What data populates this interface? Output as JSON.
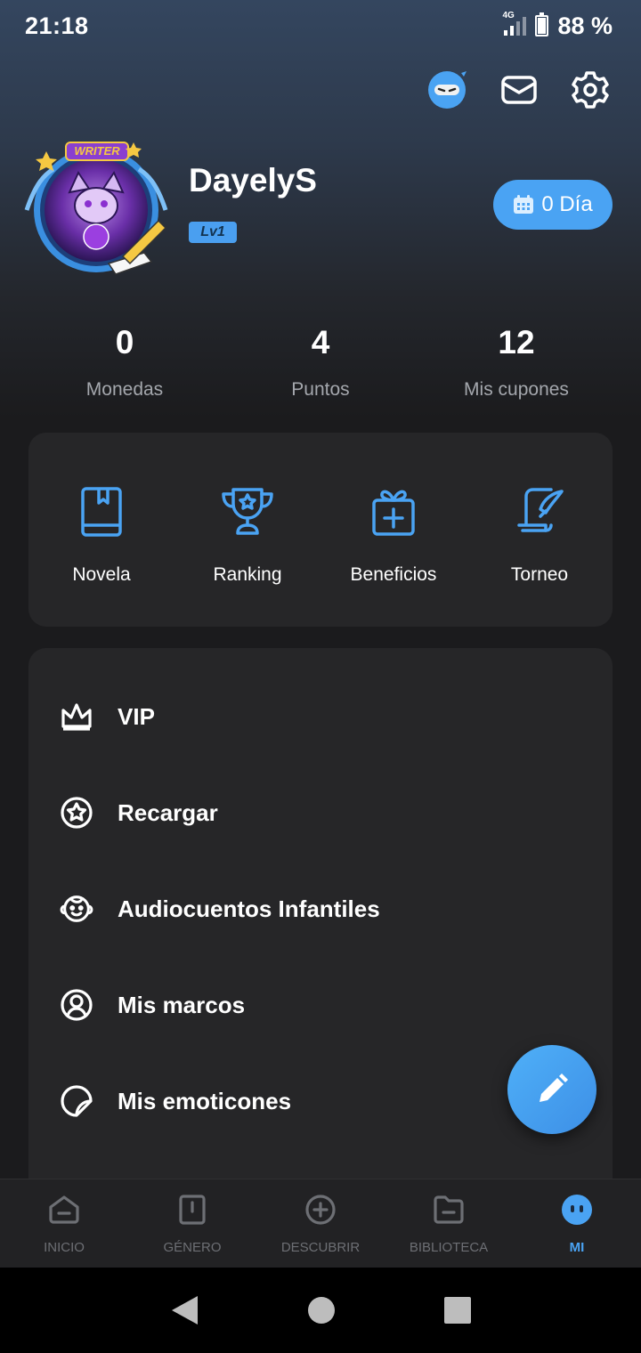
{
  "status": {
    "time": "21:18",
    "network": "4G",
    "battery": "88 %",
    "battery_level": 0.88
  },
  "header": {
    "icons": [
      "ninja-avatar-icon",
      "mail-icon",
      "gear-icon"
    ]
  },
  "profile": {
    "avatar_badge": "WRITER",
    "username": "DayelyS",
    "level": "Lv1",
    "checkin_label": "0 Día"
  },
  "stats": [
    {
      "value": "0",
      "label": "Monedas"
    },
    {
      "value": "4",
      "label": "Puntos"
    },
    {
      "value": "12",
      "label": "Mis cupones"
    }
  ],
  "quick_actions": [
    {
      "label": "Novela",
      "icon": "book-icon"
    },
    {
      "label": "Ranking",
      "icon": "trophy-icon"
    },
    {
      "label": "Beneficios",
      "icon": "gift-icon"
    },
    {
      "label": "Torneo",
      "icon": "quill-icon"
    }
  ],
  "menu": [
    {
      "label": "VIP",
      "icon": "crown-icon"
    },
    {
      "label": "Recargar",
      "icon": "star-coin-icon"
    },
    {
      "label": "Audiocuentos Infantiles",
      "icon": "child-face-icon"
    },
    {
      "label": "Mis marcos",
      "icon": "user-frame-icon"
    },
    {
      "label": "Mis emoticones",
      "icon": "sticker-icon"
    }
  ],
  "fab": {
    "icon": "pencil-icon"
  },
  "bottom_nav": [
    {
      "label": "INICIO",
      "icon": "home-icon"
    },
    {
      "label": "GÉNERO",
      "icon": "bookmark-book-icon"
    },
    {
      "label": "DESCUBRIR",
      "icon": "plus-circle-icon"
    },
    {
      "label": "BIBLIOTECA",
      "icon": "folder-icon"
    },
    {
      "label": "MI",
      "icon": "face-icon",
      "active": true
    }
  ],
  "colors": {
    "accent": "#4aa3f3",
    "card": "#262628",
    "background": "#1b1b1d"
  }
}
